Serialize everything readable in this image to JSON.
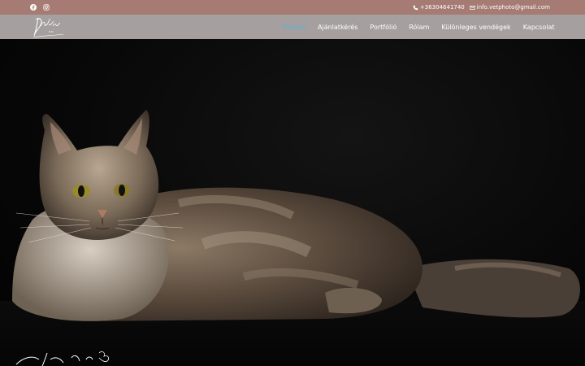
{
  "topbar": {
    "social": [
      "facebook-icon",
      "instagram-icon"
    ],
    "phone": "+36304641740",
    "email": "info.vetphoto@gmail.com"
  },
  "nav": {
    "items": [
      {
        "label": "Főoldal",
        "active": true
      },
      {
        "label": "Ajánlatkérés",
        "active": false
      },
      {
        "label": "Portfólió",
        "active": false
      },
      {
        "label": "Rólam",
        "active": false
      },
      {
        "label": "Különleges vendégek",
        "active": false
      },
      {
        "label": "Kapcsolat",
        "active": false
      }
    ]
  },
  "colors": {
    "topbar": "#a57b73",
    "navbar": "#a59f9f",
    "active_link": "#5fb0d9"
  }
}
